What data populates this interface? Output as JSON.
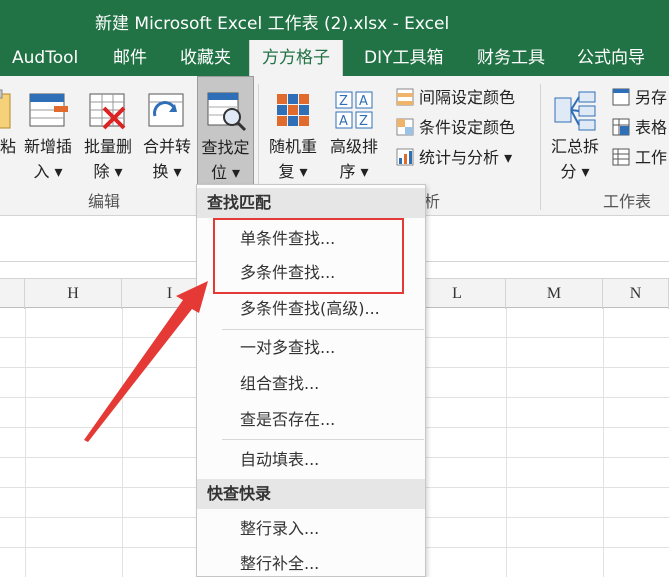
{
  "window": {
    "title": "新建 Microsoft Excel 工作表 (2).xlsx - Excel"
  },
  "tabs": [
    "AudTool",
    "邮件",
    "收藏夹",
    "方方格子",
    "DIY工具箱",
    "财务工具",
    "公式向导"
  ],
  "ribbon": {
    "buttons": [
      {
        "label1": "粘",
        "label2": ""
      },
      {
        "label1": "新增插",
        "label2": "入 ▾"
      },
      {
        "label1": "批量删",
        "label2": "除 ▾"
      },
      {
        "label1": "合并转",
        "label2": "换 ▾"
      },
      {
        "label1": "查找定",
        "label2": "位 ▾"
      },
      {
        "label1": "随机重",
        "label2": "复 ▾"
      },
      {
        "label1": "高级排",
        "label2": "序 ▾"
      },
      {
        "label1": "汇总拆",
        "label2": "分 ▾"
      }
    ],
    "small_buttons": [
      "间隔设定颜色",
      "条件设定颜色",
      "统计与分析 ▾",
      "另存",
      "表格",
      "工作"
    ],
    "groups": {
      "edit": "编辑",
      "analysis_partial": "析",
      "worksheet": "工作表"
    }
  },
  "columns": [
    "H",
    "I",
    "L",
    "M",
    "N"
  ],
  "dropdown": {
    "section1_title": "查找匹配",
    "items1": [
      "单条件查找...",
      "多条件查找...",
      "多条件查找(高级)...",
      "一对多查找...",
      "组合查找...",
      "查是否存在...",
      "自动填表..."
    ],
    "section2_title": "快查快录",
    "items2": [
      "整行录入...",
      "整行补全..."
    ]
  },
  "colors": {
    "excel_green": "#217346",
    "highlight_red": "#e53935"
  }
}
